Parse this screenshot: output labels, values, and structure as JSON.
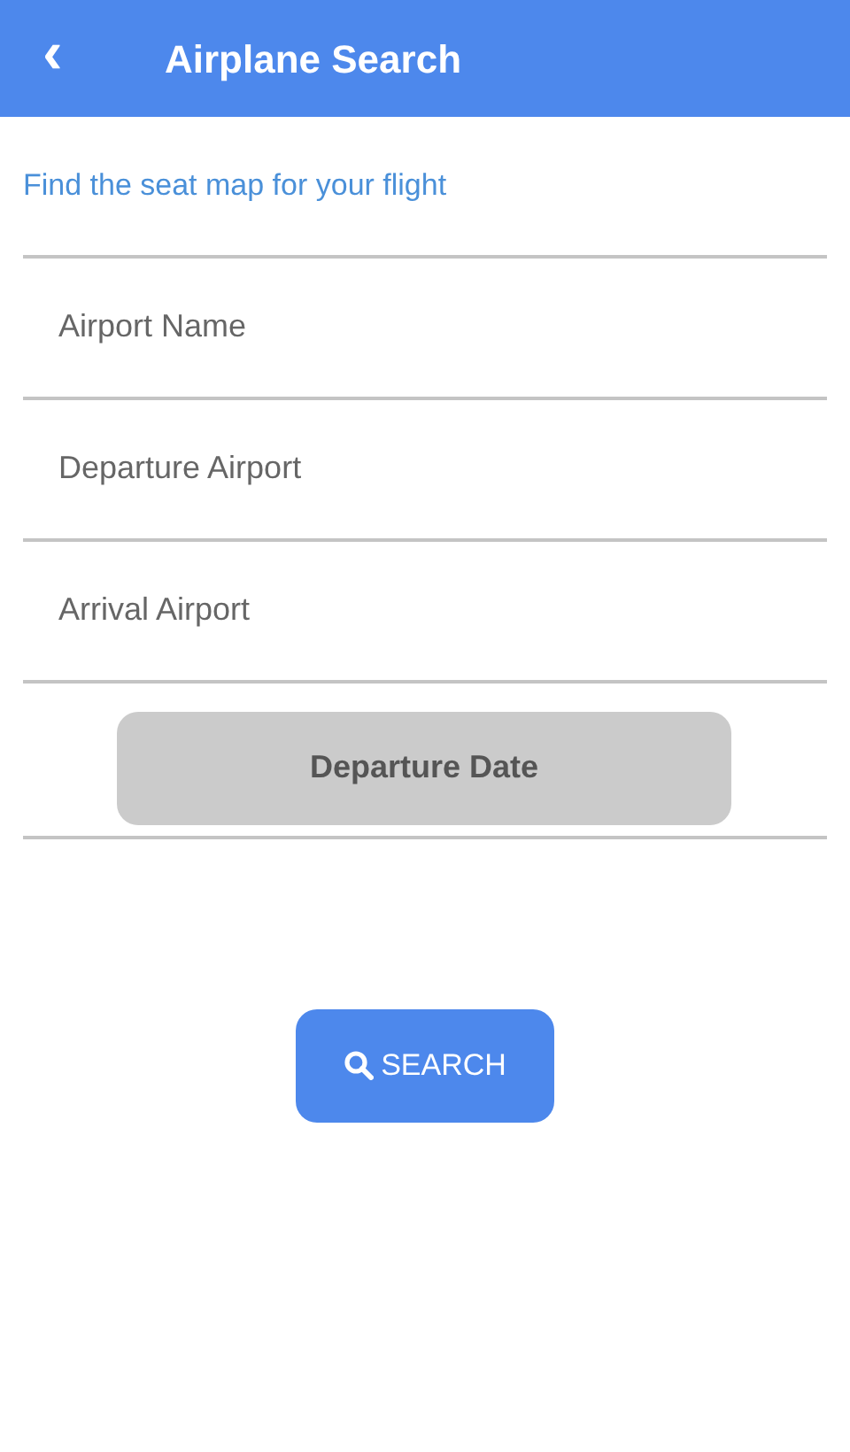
{
  "header": {
    "back": "‹",
    "title": "Airplane Search"
  },
  "subtitle": "Find the seat map for your flight",
  "fields": [
    {
      "placeholder": "Airport Name"
    },
    {
      "placeholder": "Departure Airport"
    },
    {
      "placeholder": "Arrival Airport"
    }
  ],
  "date_button": "Departure Date",
  "search_button": "SEARCH"
}
